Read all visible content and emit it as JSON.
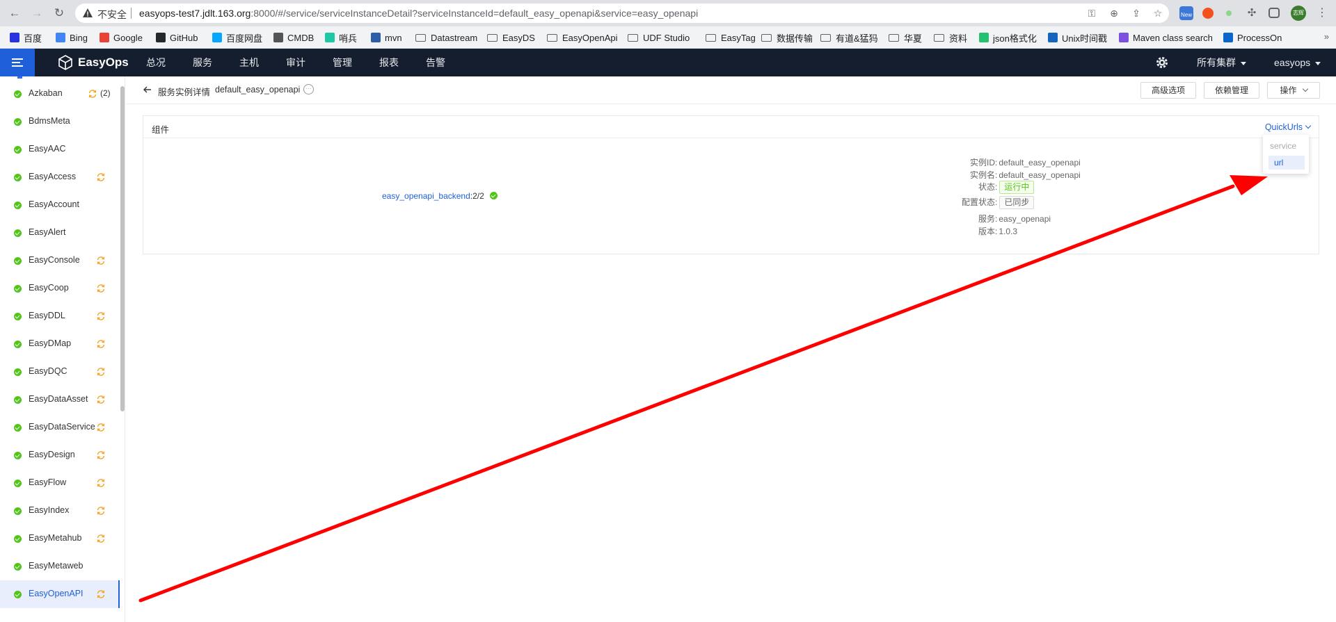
{
  "browser": {
    "insecure_label": "不安全",
    "url_host": "easyops-test7.jdlt.163.org",
    "url_rest": ":8000/#/service/serviceInstanceDetail?serviceInstanceId=default_easy_openapi&service=easy_openapi",
    "ext_new_badge": "New",
    "profile_label": "志辉",
    "bookmarks": [
      {
        "label": "百度",
        "icon": "baidu-icon",
        "color": "#2932e1"
      },
      {
        "label": "Bing",
        "icon": "search-icon",
        "color": "#4285f4"
      },
      {
        "label": "Google",
        "icon": "google-icon",
        "color": "#ea4335"
      },
      {
        "label": "GitHub",
        "icon": "github-icon",
        "color": "#24292e"
      },
      {
        "label": "百度网盘",
        "icon": "cloud-icon",
        "color": "#06a7ff"
      },
      {
        "label": "CMDB",
        "icon": "cmdb-icon",
        "color": "#555555"
      },
      {
        "label": "哨兵",
        "icon": "sentinel-icon",
        "color": "#1ec8a5"
      },
      {
        "label": "mvn",
        "icon": "maven-icon",
        "color": "#2b5fa8"
      },
      {
        "label": "Datastream",
        "icon": "folder-icon"
      },
      {
        "label": "EasyDS",
        "icon": "folder-icon"
      },
      {
        "label": "EasyOpenApi",
        "icon": "folder-icon"
      },
      {
        "label": "UDF Studio",
        "icon": "folder-icon"
      },
      {
        "label": "EasyTag",
        "icon": "folder-icon"
      },
      {
        "label": "数据传输",
        "icon": "folder-icon"
      },
      {
        "label": "有道&猛犸",
        "icon": "folder-icon"
      },
      {
        "label": "华夏",
        "icon": "folder-icon"
      },
      {
        "label": "资料",
        "icon": "folder-icon"
      },
      {
        "label": "json格式化",
        "icon": "json-icon",
        "color": "#25c16f"
      },
      {
        "label": "Unix时间戳",
        "icon": "unix-icon",
        "color": "#1565c0"
      },
      {
        "label": "Maven class search",
        "icon": "maven-search-icon",
        "color": "#7b4fe0"
      },
      {
        "label": "ProcessOn",
        "icon": "processon-icon",
        "color": "#0a65cc"
      }
    ],
    "bookmarks_more": "»"
  },
  "app": {
    "logo_text": "EasyOps",
    "nav": [
      "总况",
      "服务",
      "主机",
      "审计",
      "管理",
      "报表",
      "告警"
    ],
    "cluster_label": "所有集群",
    "user_label": "easyops"
  },
  "sidebar": {
    "items": [
      {
        "label": "Azkaban",
        "sync": true,
        "count": "(2)"
      },
      {
        "label": "BdmsMeta",
        "sync": false
      },
      {
        "label": "EasyAAC",
        "sync": false
      },
      {
        "label": "EasyAccess",
        "sync": true
      },
      {
        "label": "EasyAccount",
        "sync": false
      },
      {
        "label": "EasyAlert",
        "sync": false
      },
      {
        "label": "EasyConsole",
        "sync": true
      },
      {
        "label": "EasyCoop",
        "sync": true
      },
      {
        "label": "EasyDDL",
        "sync": true
      },
      {
        "label": "EasyDMap",
        "sync": true
      },
      {
        "label": "EasyDQC",
        "sync": true
      },
      {
        "label": "EasyDataAsset",
        "sync": true
      },
      {
        "label": "EasyDataService",
        "sync": true
      },
      {
        "label": "EasyDesign",
        "sync": true
      },
      {
        "label": "EasyFlow",
        "sync": true
      },
      {
        "label": "EasyIndex",
        "sync": true
      },
      {
        "label": "EasyMetahub",
        "sync": true
      },
      {
        "label": "EasyMetaweb",
        "sync": false
      },
      {
        "label": "EasyOpenAPI",
        "sync": true,
        "active": true
      }
    ]
  },
  "page": {
    "breadcrumb_title": "服务实例详情",
    "instance_name": "default_easy_openapi",
    "buttons": {
      "advanced": "高级选项",
      "deps": "依赖管理",
      "actions": "操作"
    }
  },
  "card": {
    "title": "组件",
    "quickurls_label": "QuickUrls",
    "component_name": "easy_openapi_backend",
    "component_count": ":2/2",
    "info": [
      {
        "key": "实例ID",
        "value": "default_easy_openapi"
      },
      {
        "key": "实例名",
        "value": "default_easy_openapi"
      },
      {
        "key": "状态",
        "value": "运行中",
        "tag": "run"
      },
      {
        "key": "配置状态",
        "value": "已同步",
        "tag": "sync"
      },
      {
        "key": "服务",
        "value": "easy_openapi"
      },
      {
        "key": "版本",
        "value": "1.0.3"
      }
    ],
    "dropdown": {
      "group": "service",
      "item": "url"
    }
  },
  "colors": {
    "accent": "#1f5fd9",
    "header_bg": "#141e2f",
    "ok": "#52c41a",
    "sync": "#f5a623",
    "arrow": "#ff0000"
  }
}
